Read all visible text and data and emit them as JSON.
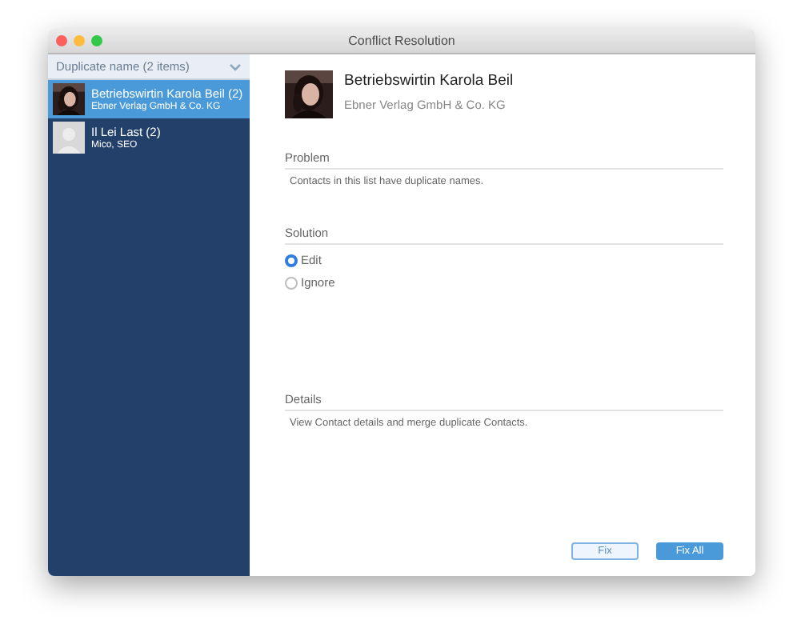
{
  "window": {
    "title": "Conflict Resolution"
  },
  "sidebar": {
    "filter": {
      "value": "Duplicate name (2 items)"
    },
    "items": [
      {
        "name": "Betriebswirtin Karola Beil (2)",
        "subtitle": "Ebner Verlag GmbH & Co. KG",
        "selected": true
      },
      {
        "name": "Il Lei Last (2)",
        "subtitle": "Mico, SEO",
        "selected": false,
        "avatar": {
          "kind": "placeholder"
        }
      }
    ]
  },
  "detail": {
    "name": "Betriebswirtin Karola Beil",
    "subtitle": "Ebner Verlag GmbH & Co. KG",
    "sections": [
      {
        "kind": "text",
        "heading": "Problem",
        "text": "Contacts in this list have duplicate names."
      },
      {
        "kind": "radio",
        "heading": "Solution",
        "options": [
          {
            "label": "Edit",
            "selected": true
          },
          {
            "label": "Ignore",
            "selected": false
          }
        ]
      },
      {
        "kind": "text",
        "heading": "Details",
        "text": "View Contact details and merge duplicate Contacts."
      }
    ]
  },
  "buttons": [
    {
      "label": "Fix",
      "primary": false
    },
    {
      "label": "Fix All",
      "primary": true
    }
  ]
}
